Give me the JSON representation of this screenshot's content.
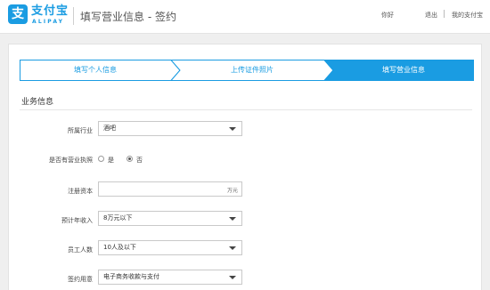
{
  "header": {
    "logo_mark": "支",
    "logo_cn": "支付宝",
    "logo_en": "ALIPAY",
    "page_title": "填写营业信息 - 签约",
    "greeting": "你好",
    "logout": "退出",
    "my_alipay": "我的支付宝"
  },
  "steps": [
    {
      "label": "填写个人信息",
      "state": "done"
    },
    {
      "label": "上传证件照片",
      "state": "done"
    },
    {
      "label": "填写营业信息",
      "state": "active"
    }
  ],
  "colors": {
    "accent": "#1a9ce2",
    "step_border": "#1a9ce2"
  },
  "section": {
    "title": "业务信息"
  },
  "form": {
    "industry": {
      "label": "所属行业",
      "value": "酒吧"
    },
    "license": {
      "label": "是否有营业执照",
      "options": [
        {
          "label": "是",
          "checked": false
        },
        {
          "label": "否",
          "checked": true
        }
      ]
    },
    "capital": {
      "label": "注册资本",
      "value": "",
      "suffix": "万元"
    },
    "revenue": {
      "label": "预计年收入",
      "value": "8万元以下"
    },
    "employees": {
      "label": "员工人数",
      "value": "10人及以下"
    },
    "purpose": {
      "label": "签约用意",
      "value": "电子商务收款与支付"
    }
  }
}
